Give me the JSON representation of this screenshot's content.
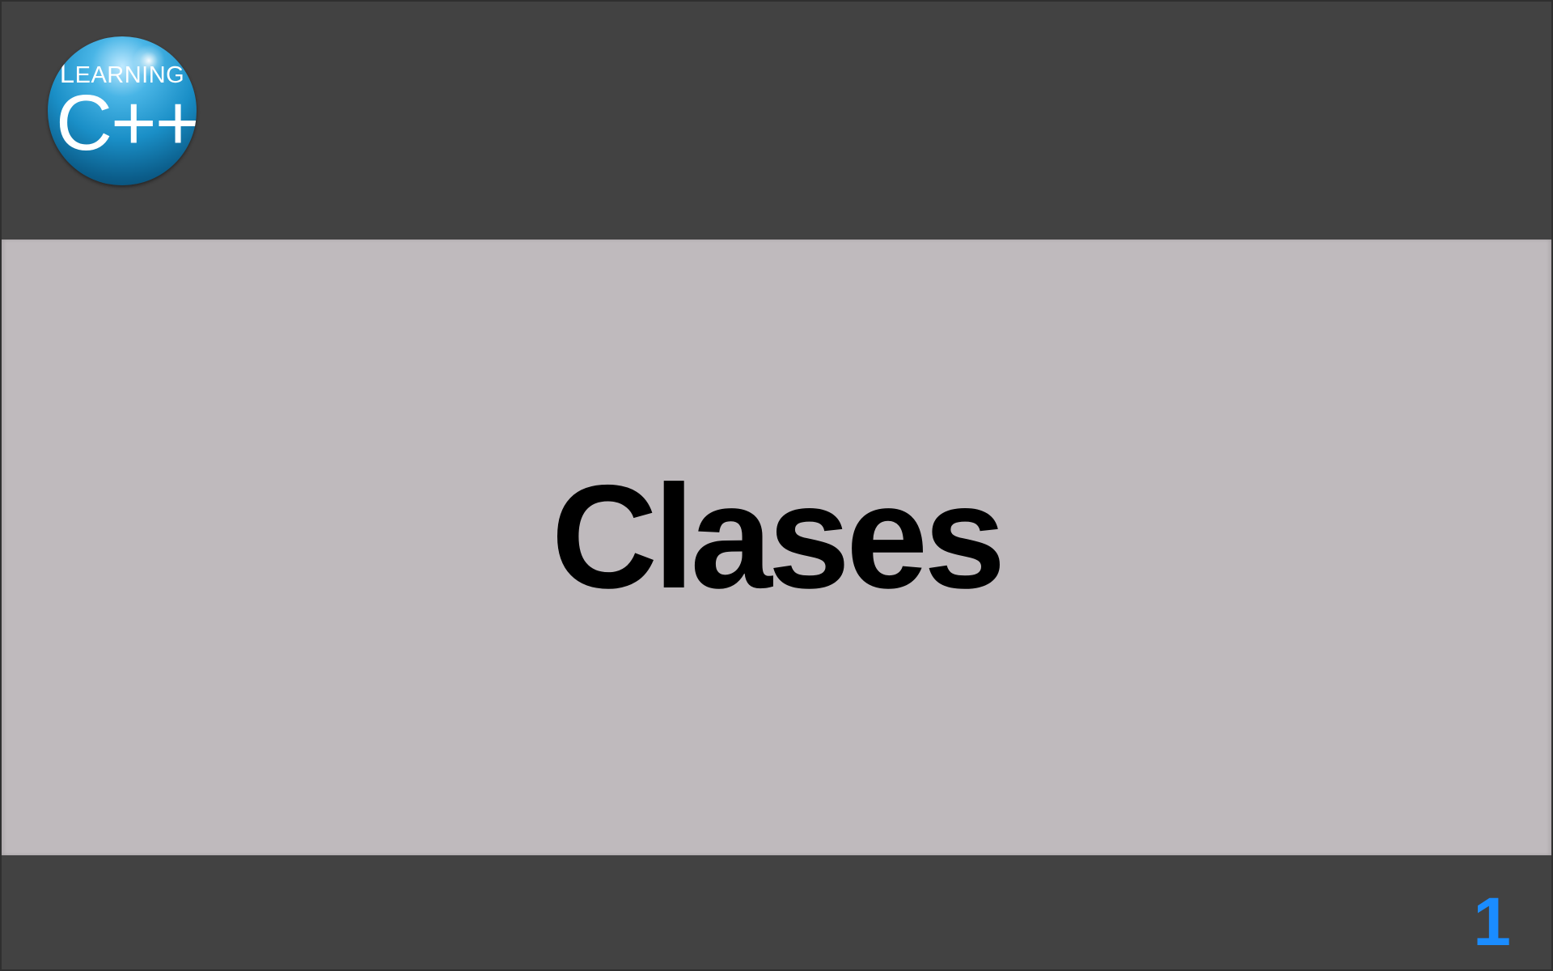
{
  "logo": {
    "top_text": "Learning",
    "main_text": "C++"
  },
  "slide": {
    "title": "Clases",
    "page_number": "1"
  },
  "colors": {
    "top_bar": "#424242",
    "content_band": "#bfbabd",
    "bottom_bar": "#424242",
    "page_number": "#1a8cff",
    "title": "#000000"
  }
}
